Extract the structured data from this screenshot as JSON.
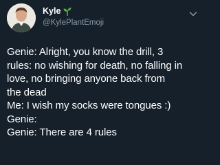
{
  "tweet": {
    "display_name": "Kyle",
    "name_emoji_icon": "seedling-icon",
    "handle": "@KylePlantEmoji",
    "menu_icon": "chevron-down-icon",
    "lines": [
      "Genie: Alright, you know the drill, 3",
      "rules: no wishing for death, no falling in",
      "love, no bringing anyone back from",
      "the dead",
      "Me: I wish my socks were tongues :)",
      "Genie:",
      "Genie: There are 4 rules"
    ]
  },
  "colors": {
    "background": "#15202b",
    "text": "#ffffff",
    "secondary_text": "#8899a6"
  }
}
